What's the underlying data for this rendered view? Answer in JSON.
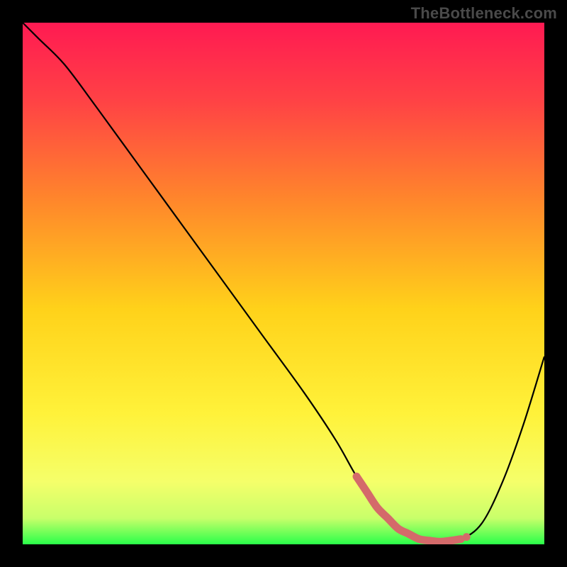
{
  "watermark": "TheBottleneck.com",
  "colors": {
    "frame": "#000000",
    "gradient_stops": [
      {
        "offset": 0.0,
        "color": "#ff1a52"
      },
      {
        "offset": 0.15,
        "color": "#ff4245"
      },
      {
        "offset": 0.35,
        "color": "#ff8a2a"
      },
      {
        "offset": 0.55,
        "color": "#ffd21a"
      },
      {
        "offset": 0.75,
        "color": "#fff23a"
      },
      {
        "offset": 0.88,
        "color": "#f5ff6a"
      },
      {
        "offset": 0.95,
        "color": "#c8ff6a"
      },
      {
        "offset": 1.0,
        "color": "#2aff4a"
      }
    ],
    "curve": "#000000",
    "marker_fill": "#d46a6a",
    "marker_stroke": "#b85a5a"
  },
  "chart_data": {
    "type": "line",
    "title": "",
    "xlabel": "",
    "ylabel": "",
    "xlim": [
      0,
      100
    ],
    "ylim": [
      0,
      100
    ],
    "grid": false,
    "legend": false,
    "series": [
      {
        "name": "bottleneck-curve",
        "x": [
          0,
          3,
          8,
          14,
          22,
          30,
          38,
          46,
          54,
          60,
          64,
          68,
          72,
          76,
          80,
          84,
          88,
          92,
          96,
          100
        ],
        "values": [
          100,
          97,
          92,
          84,
          73,
          62,
          51,
          40,
          29,
          20,
          13,
          7,
          3,
          1,
          0.5,
          1,
          4,
          12,
          23,
          36
        ]
      }
    ],
    "markers": {
      "name": "highlight-region",
      "x": [
        64,
        66,
        68,
        70,
        72,
        74,
        76,
        78,
        80,
        82,
        84
      ],
      "values": [
        13,
        10,
        7,
        5,
        3,
        2,
        1,
        0.7,
        0.5,
        0.7,
        1
      ]
    }
  }
}
